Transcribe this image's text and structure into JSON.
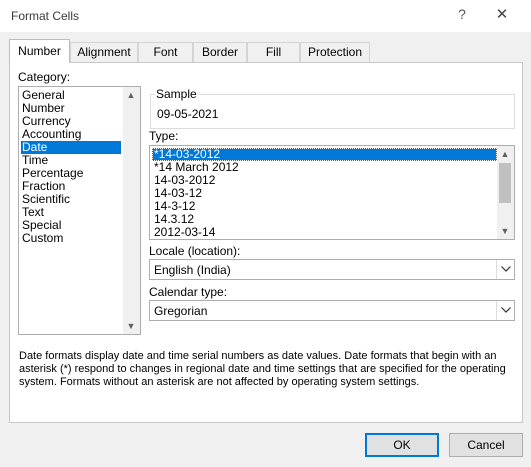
{
  "window": {
    "title": "Format Cells",
    "help_glyph": "?",
    "close_glyph": "✕"
  },
  "tabs": [
    {
      "label": "Number",
      "active": true
    },
    {
      "label": "Alignment"
    },
    {
      "label": "Font"
    },
    {
      "label": "Border"
    },
    {
      "label": "Fill"
    },
    {
      "label": "Protection"
    }
  ],
  "category": {
    "label": "Category:",
    "items": [
      "General",
      "Number",
      "Currency",
      "Accounting",
      "Date",
      "Time",
      "Percentage",
      "Fraction",
      "Scientific",
      "Text",
      "Special",
      "Custom"
    ],
    "selected": "Date"
  },
  "sample": {
    "label": "Sample",
    "value": "09-05-2021"
  },
  "type": {
    "label": "Type:",
    "items": [
      "*14-03-2012",
      "*14 March 2012",
      "14-03-2012",
      "14-03-12",
      "14-3-12",
      "14.3.12",
      "2012-03-14"
    ],
    "selected": "*14-03-2012"
  },
  "locale": {
    "label": "Locale (location):",
    "value": "English (India)"
  },
  "calendar": {
    "label": "Calendar type:",
    "value": "Gregorian"
  },
  "description": "Date formats display date and time serial numbers as date values.  Date formats that begin with an asterisk (*) respond to changes in regional date and time settings that are specified for the operating system. Formats without an asterisk are not affected by operating system settings.",
  "buttons": {
    "ok": "OK",
    "cancel": "Cancel"
  },
  "colors": {
    "selection": "#0078d7",
    "background": "#f0f0f0"
  }
}
